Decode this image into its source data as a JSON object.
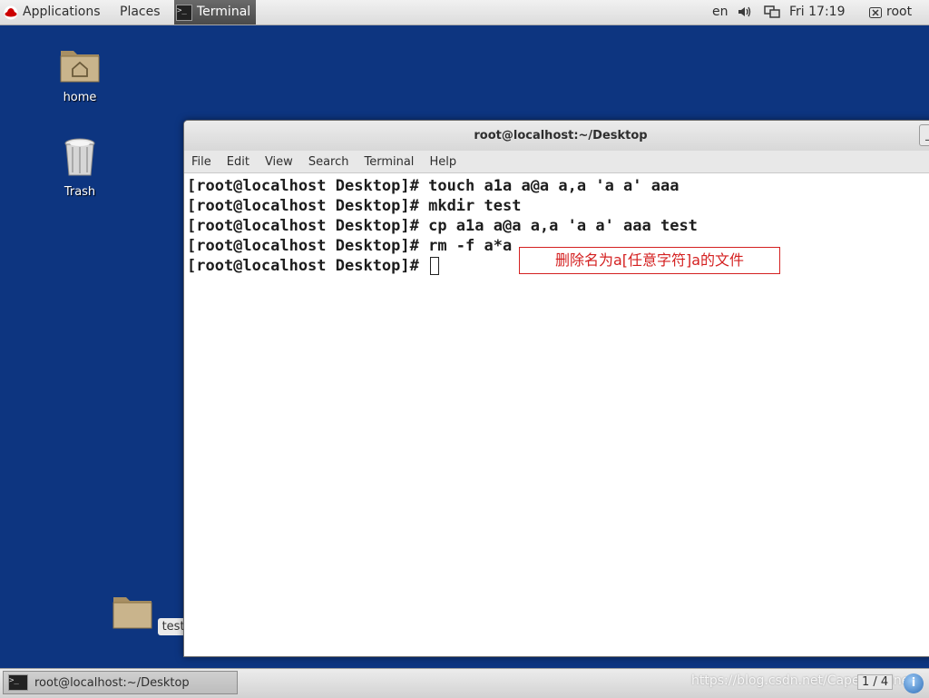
{
  "top_panel": {
    "applications": "Applications",
    "places": "Places",
    "terminal": "Terminal",
    "lang": "en",
    "clock": "Fri 17:19",
    "user": "root"
  },
  "desktop": {
    "home": "home",
    "trash": "Trash",
    "test": "test"
  },
  "window": {
    "title": "root@localhost:~/Desktop",
    "menu": [
      "File",
      "Edit",
      "View",
      "Search",
      "Terminal",
      "Help"
    ],
    "lines": [
      "[root@localhost Desktop]# touch a1a a@a a,a 'a a' aaa",
      "[root@localhost Desktop]# mkdir test",
      "[root@localhost Desktop]# cp a1a a@a a,a 'a a' aaa test",
      "[root@localhost Desktop]# rm -f a*a",
      "[root@localhost Desktop]# "
    ],
    "annotation": "删除名为a[任意字符]a的文件"
  },
  "bottom_panel": {
    "task": "root@localhost:~/Desktop",
    "workspace": "1 / 4",
    "watermark": "https://blog.csdn.net/Capejasmine"
  },
  "colors": {
    "desktop_bg": "#0d3580",
    "annotation": "#d42020"
  }
}
